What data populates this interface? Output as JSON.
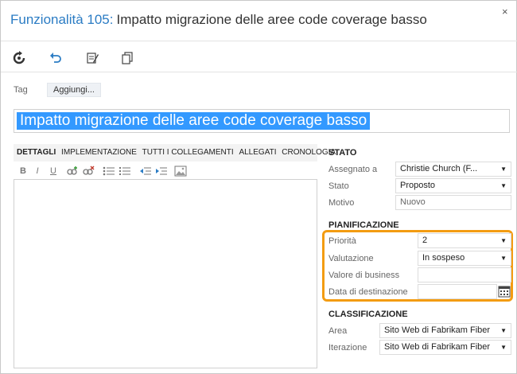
{
  "header": {
    "work_item_type": "Funzionalità 105:",
    "title": "Impatto migrazione delle aree code coverage basso",
    "close": "×"
  },
  "toolbar": {
    "items": [
      {
        "name": "refresh-icon"
      },
      {
        "name": "undo-icon"
      },
      {
        "name": "edit-list-icon"
      },
      {
        "name": "copy-icon"
      }
    ]
  },
  "tags": {
    "label": "Tag",
    "add_button": "Aggiungi..."
  },
  "title_field": {
    "value": "Impatto migrazione delle aree code coverage basso"
  },
  "tabs": [
    "DETTAGLI",
    "IMPLEMENTAZIONE",
    "TUTTI I COLLEGAMENTI",
    "ALLEGATI",
    "CRONOLOGIA"
  ],
  "format_bar": {
    "bold": "B",
    "italic": "I",
    "underline": "U"
  },
  "stato": {
    "heading": "STATO",
    "assegnato_label": "Assegnato a",
    "assegnato_value": "Christie Church (F...",
    "stato_label": "Stato",
    "stato_value": "Proposto",
    "motivo_label": "Motivo",
    "motivo_value": "Nuovo"
  },
  "pianificazione": {
    "heading": "PIANIFICAZIONE",
    "priorita_label": "Priorità",
    "priorita_value": "2",
    "valutazione_label": "Valutazione",
    "valutazione_value": "In sospeso",
    "valore_label": "Valore di business",
    "valore_value": "",
    "data_label": "Data di destinazione",
    "data_value": ""
  },
  "classificazione": {
    "heading": "CLASSIFICAZIONE",
    "area_label": "Area",
    "area_value": "Sito Web di Fabrikam Fiber",
    "iterazione_label": "Iterazione",
    "iterazione_value": "Sito Web di Fabrikam Fiber"
  },
  "colors": {
    "accent_blue": "#2b7cc4",
    "selection": "#3399ff",
    "highlight_orange": "#f39c12"
  }
}
